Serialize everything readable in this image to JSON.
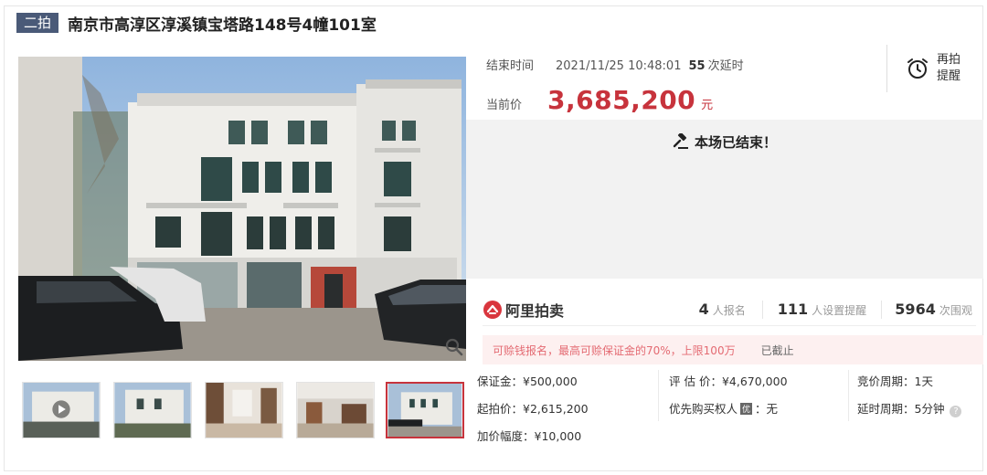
{
  "header": {
    "round_badge": "二拍",
    "title": "南京市高淳区淳溪镇宝塔路148号4幢101室"
  },
  "auction": {
    "end_label": "结束时间",
    "end_time": "2021/11/25 10:48:01",
    "delay_count": "55",
    "delay_label": "次延时",
    "price_label": "当前价",
    "current_price": "3,685,200",
    "price_unit": "元",
    "remind_line1": "再拍",
    "remind_line2": "提醒",
    "ended_text": "本场已结束！"
  },
  "stats": {
    "brand": "阿里拍卖",
    "signups_num": "4",
    "signups_label": "人报名",
    "reminders_num": "111",
    "reminders_label": "人设置提醒",
    "views_num": "5964",
    "views_label": "次围观"
  },
  "notice": {
    "text": "可赊钱报名，最高可赊保证金的70%，上限100万",
    "status": "已截止"
  },
  "terms": {
    "deposit": "保证金：¥500,000",
    "appraisal": "评 估 价：¥4,670,000",
    "bid_period": "竞价周期：1天",
    "start_price": "起拍价：¥2,615,200",
    "priority_label": "优先购买权人",
    "priority_badge": "优",
    "priority_value": "：无",
    "delay_period": "延时周期：5分钟",
    "increment": "加价幅度：¥10,000"
  },
  "icons": {
    "zoom": "search-icon",
    "alarm": "alarm-clock-icon",
    "gavel": "gavel-icon",
    "brand": "ali-auction-logo-icon",
    "help": "help-icon"
  },
  "colors": {
    "accent": "#c7333c",
    "badge_bg": "#4a5a78",
    "notice_bg": "#fdf0f0",
    "notice_text": "#e46a72"
  }
}
